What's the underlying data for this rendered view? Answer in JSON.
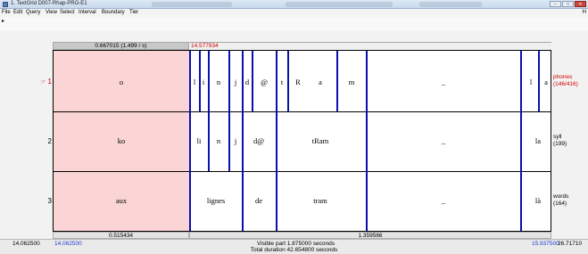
{
  "window": {
    "title": "1. TextGrid D007-Rhap-PRO-E1",
    "buttons": [
      "−",
      "□",
      "✕"
    ]
  },
  "menu": {
    "items": [
      "File",
      "Edit",
      "Query",
      "View",
      "Select",
      "Interval",
      "Boundary",
      "Tier"
    ],
    "help": "H"
  },
  "toolbar": {
    "arrow": "▸"
  },
  "selection": {
    "left_label": "0.667015 (1.499 / s)",
    "cursor_time": "14.577934"
  },
  "tiers": [
    {
      "number": "1",
      "active": true,
      "marker": "☞",
      "name": "phones",
      "count": "(146/416)",
      "labels": [
        "o",
        "l",
        "i",
        "n",
        "j",
        "d",
        "@",
        "t",
        "R",
        "a",
        "m",
        "_",
        "l",
        "a"
      ]
    },
    {
      "number": "2",
      "active": false,
      "name": "syll",
      "count": "(199)",
      "labels": [
        "ko",
        "li",
        "n",
        "j",
        "d@",
        "tRam",
        "_",
        "la"
      ]
    },
    {
      "number": "3",
      "active": false,
      "name": "words",
      "count": "(164)",
      "labels": [
        "aux",
        "lignes",
        "de",
        "tram",
        "_",
        "là"
      ]
    }
  ],
  "durations": {
    "selected": "0.515434",
    "right": "1.359566"
  },
  "bottom": {
    "window_start": "14.062500",
    "visible_start": "14.062500",
    "visible_part": "Visible part 1.875000 seconds",
    "visible_end": "15.937500",
    "window_end": "26.71710",
    "total_duration": "Total duration 42.654800 seconds"
  },
  "colors": {
    "selection": "#fbd5d5",
    "boundary": "#0a0fb0",
    "active_tier": "#d00000",
    "time_blue": "#1f3fcf"
  }
}
